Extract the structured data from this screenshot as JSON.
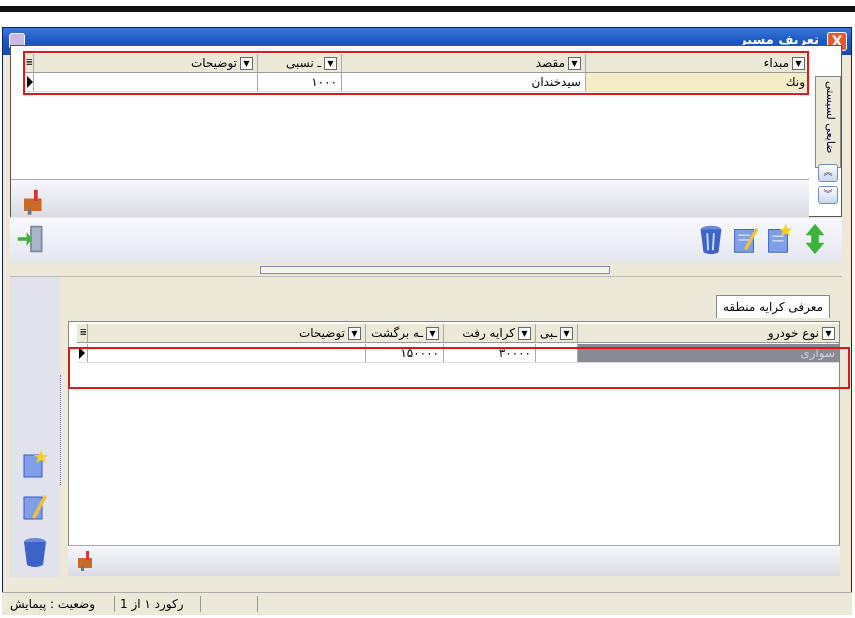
{
  "window": {
    "title": "تعریف مسیر",
    "close_label": "X"
  },
  "top_grid": {
    "columns": [
      "مبداء",
      "مقصد",
      "ـ نسبی",
      "توضیحات"
    ],
    "rows": [
      {
        "origin": "ونك",
        "destination": "سيدخندان",
        "relative": "۱۰۰۰",
        "notes": ""
      }
    ]
  },
  "side_tab": {
    "label": "ضایعی لسیستی"
  },
  "bottom": {
    "tab_label": "معرفی کرایه منطقه",
    "columns": [
      "نوع خودرو",
      "ـبی",
      "کرایه رفت",
      "ـه برگشت",
      "توضیحات"
    ],
    "rows": [
      {
        "vehicle": "سواری",
        "col2": "",
        "fare_go": "۳۰۰۰۰",
        "fare_return": "۱۵۰۰۰۰",
        "notes": ""
      }
    ]
  },
  "status": {
    "record": "رکورد ۱ از 1",
    "state": "وضعیت : پیمایش"
  },
  "colors": {
    "title_bar": "#1f59c4",
    "highlight": "#e0161e",
    "selected_row": "#f4ecc4"
  },
  "icons": [
    "exit-icon",
    "trash-icon",
    "edit-icon",
    "new-icon",
    "move-icon",
    "mailbox-icon"
  ]
}
